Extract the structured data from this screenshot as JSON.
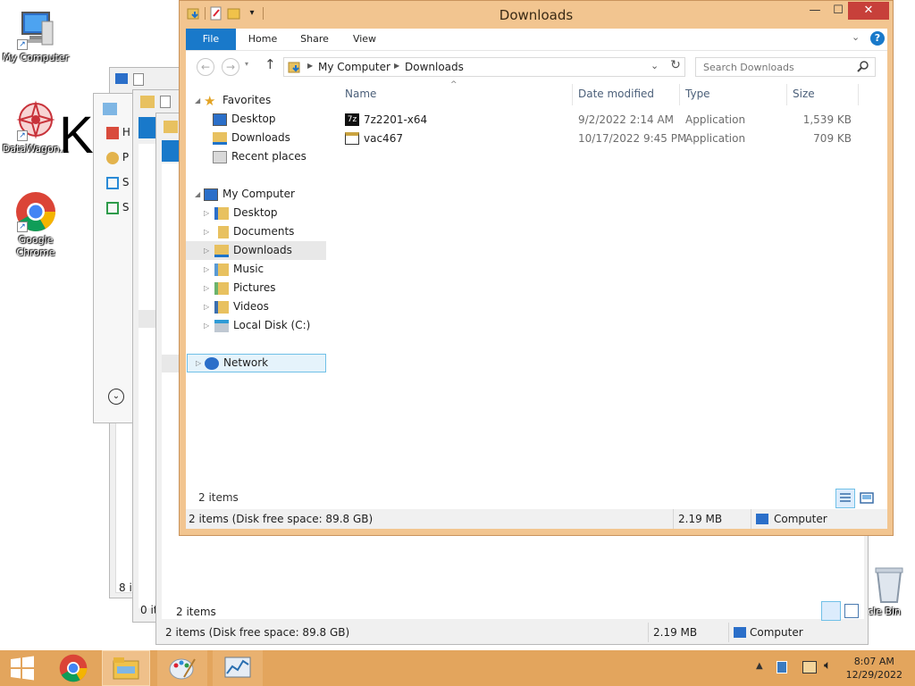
{
  "desktop": {
    "icons": [
      {
        "label": "My Computer"
      },
      {
        "label": "DataWagon..."
      },
      {
        "label": "Google Chrome"
      },
      {
        "label": "cle Bin"
      }
    ]
  },
  "bg_windows": {
    "w1": {
      "items": [
        "H",
        "P",
        "S",
        "S"
      ],
      "status": "8 it"
    },
    "w2": {
      "status": "0 it"
    },
    "w3": {
      "items_count": "2 items",
      "status_left": "2 items (Disk free space: 89.8 GB)",
      "status_size": "2.19 MB",
      "status_location": "Computer"
    }
  },
  "window": {
    "title": "Downloads",
    "tabs": [
      "File",
      "Home",
      "Share",
      "View"
    ],
    "address": {
      "segments": [
        "My Computer",
        "Downloads"
      ]
    },
    "search_placeholder": "Search Downloads",
    "nav": {
      "favorites_label": "Favorites",
      "favorites": [
        "Desktop",
        "Downloads",
        "Recent places"
      ],
      "computer_label": "My Computer",
      "computer": [
        "Desktop",
        "Documents",
        "Downloads",
        "Music",
        "Pictures",
        "Videos",
        "Local Disk (C:)"
      ],
      "network_label": "Network"
    },
    "columns": [
      "Name",
      "Date modified",
      "Type",
      "Size"
    ],
    "files": [
      {
        "name": "7z2201-x64",
        "date": "9/2/2022 2:14 AM",
        "type": "Application",
        "size": "1,539 KB"
      },
      {
        "name": "vac467",
        "date": "10/17/2022 9:45 PM",
        "type": "Application",
        "size": "709 KB"
      }
    ],
    "items_count": "2 items",
    "status": {
      "left": "2 items (Disk free space: 89.8 GB)",
      "size": "2.19 MB",
      "location": "Computer"
    }
  },
  "taskbar": {
    "time": "8:07 AM",
    "date": "12/29/2022"
  },
  "colors": {
    "accent": "#1979ca",
    "window_frame": "#f2c590",
    "taskbar": "#e3a55d",
    "close": "#c7403a"
  }
}
